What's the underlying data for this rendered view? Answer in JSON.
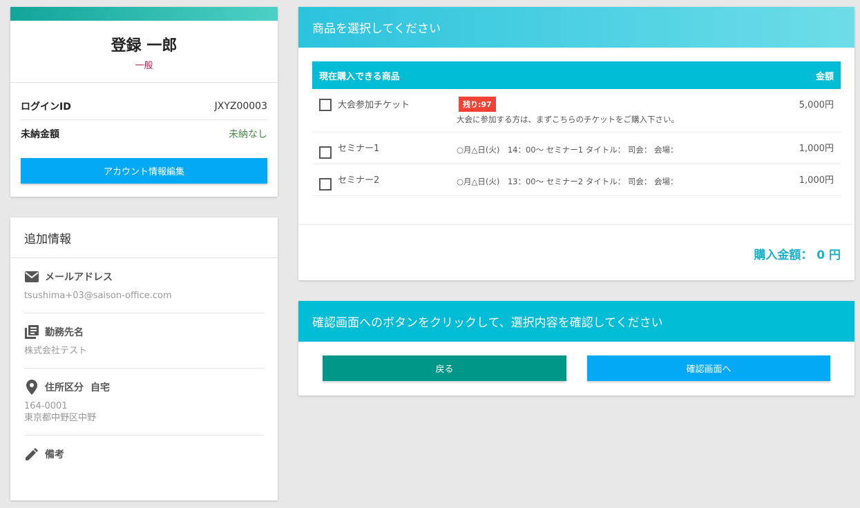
{
  "profile": {
    "name": "登録 一郎",
    "role": "一般",
    "login_id_label": "ログインID",
    "login_id_value": "JXYZ00003",
    "unpaid_label": "未納金額",
    "unpaid_value": "未納なし",
    "edit_button": "アカウント情報編集"
  },
  "extra_info": {
    "title": "追加情報",
    "email_label": "メールアドレス",
    "email_value": "tsushima+03@saison-office.com",
    "email_icon": "mail-icon",
    "company_label": "勤務先名",
    "company_value": "株式会社テスト",
    "company_icon": "library-books-icon",
    "address_label": "住所区分",
    "address_type": "自宅",
    "address_icon": "place-icon",
    "postal_code": "164-0001",
    "address_line": "東京都中野区中野",
    "notes_label": "備考",
    "notes_icon": "pencil-icon"
  },
  "products": {
    "title": "商品を選択してください",
    "column_name": "現在購入できる商品",
    "column_price": "金額",
    "items": [
      {
        "name": "大会参加チケット",
        "badge": "残り:97",
        "description": "大会に参加する方は、まずこちらのチケットをご購入下さい。",
        "price": "5,000円",
        "checked": false
      },
      {
        "name": "セミナー1",
        "description": "○月△日(火)　14：00～ セミナー1 タイトル：  司会：  会場：",
        "price": "1,000円",
        "checked": false
      },
      {
        "name": "セミナー2",
        "description": "○月△日(火)　13：00～ セミナー2 タイトル：  司会：  会場：",
        "price": "1,000円",
        "checked": false
      }
    ],
    "total": "購入金額： 0 円"
  },
  "confirm": {
    "title": "確認画面へのボタンをクリックして、選択内容を確認してください",
    "back_button": "戻る",
    "confirm_button": "確認画面へ"
  },
  "colors": {
    "teal": "#009688",
    "cyan": "#00bcd4",
    "blue": "#03a9f4",
    "red": "#f44336",
    "role": "#b0164e"
  }
}
